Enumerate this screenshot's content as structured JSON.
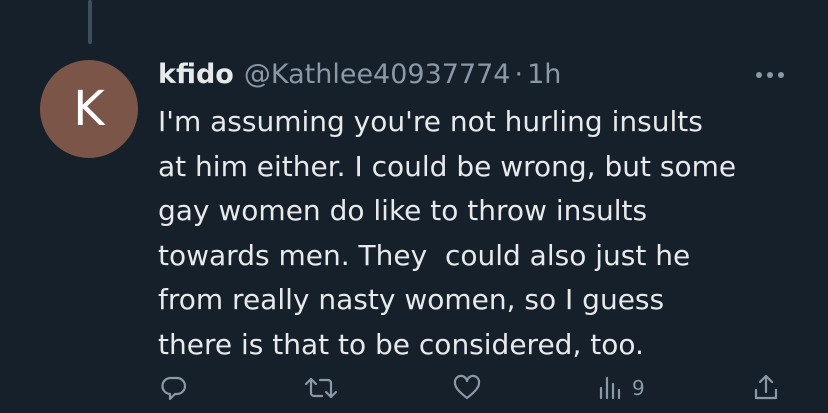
{
  "tweet": {
    "avatar_letter": "K",
    "display_name": "kfido",
    "handle": "@Kathlee40937774",
    "separator": "·",
    "time": "1h",
    "text": "I'm assuming you're not hurling insults\nat him either. I could be wrong, but some\ngay women do like to throw insults\ntowards men. They  could also just he\nfrom really nasty women, so I guess\nthere is that to be considered, too.",
    "more_icon": "more-horizontal-icon"
  },
  "actions": {
    "reply_icon": "reply-icon",
    "retweet_icon": "retweet-icon",
    "like_icon": "like-icon",
    "views_icon": "views-icon",
    "views_count": "9",
    "share_icon": "share-icon"
  },
  "colors": {
    "background": "#15202b",
    "text": "#e7e9ea",
    "muted": "#8b98a5",
    "avatar": "#7b5648",
    "thread_line": "#3d4f5d"
  }
}
